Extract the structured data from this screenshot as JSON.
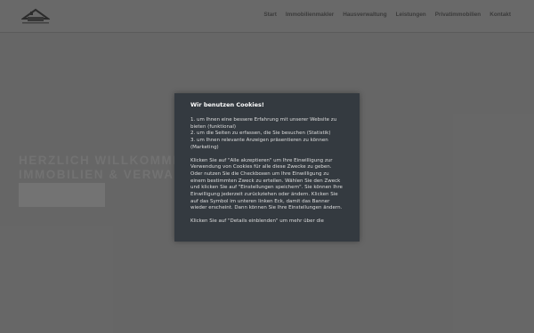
{
  "nav": {
    "items": [
      "Start",
      "Immobilienmakler",
      "Hausverwaltung",
      "Leistungen",
      "Privatimmobilien",
      "Kontakt"
    ]
  },
  "hero": {
    "line1": "HERZLICH WILLKOMMEN BEI",
    "line2": "IMMOBILIEN & VERWALTUNG"
  },
  "cookie": {
    "title": "Wir benutzen Cookies!",
    "list": "1. um Ihnen eine bessere Erfahrung mit unserer Website zu bieten (funktional)\n2. um die Seiten zu erfassen, die Sie besuchen (Statistik)\n3. um Ihnen relevante Anzeigen präsentieren zu können (Marketing)",
    "body": "Klicken Sie auf \"Alle akzeptieren\" um Ihre Einwilligung zur Verwendung von Cookies für alle diese Zwecke zu geben. Oder nutzen Sie die Checkboxen um Ihre Einwilligung zu einem bestimmten Zweck zu erteilen. Wählen Sie den Zweck und klicken Sie auf \"Einstellungen speichern\". Sie können Ihre Einwilligung jederzeit zurückziehen oder ändern. Klicken Sie auf das Symbol im unteren linken Eck, damit das Banner wieder erscheint. Dann können Sie Ihre Einstellungen ändern.",
    "details": "Klicken Sie auf \"Details einblenden\" um mehr über die"
  },
  "colors": {
    "modal_bg": "#343a40",
    "page_bg": "#6b6b6b"
  }
}
